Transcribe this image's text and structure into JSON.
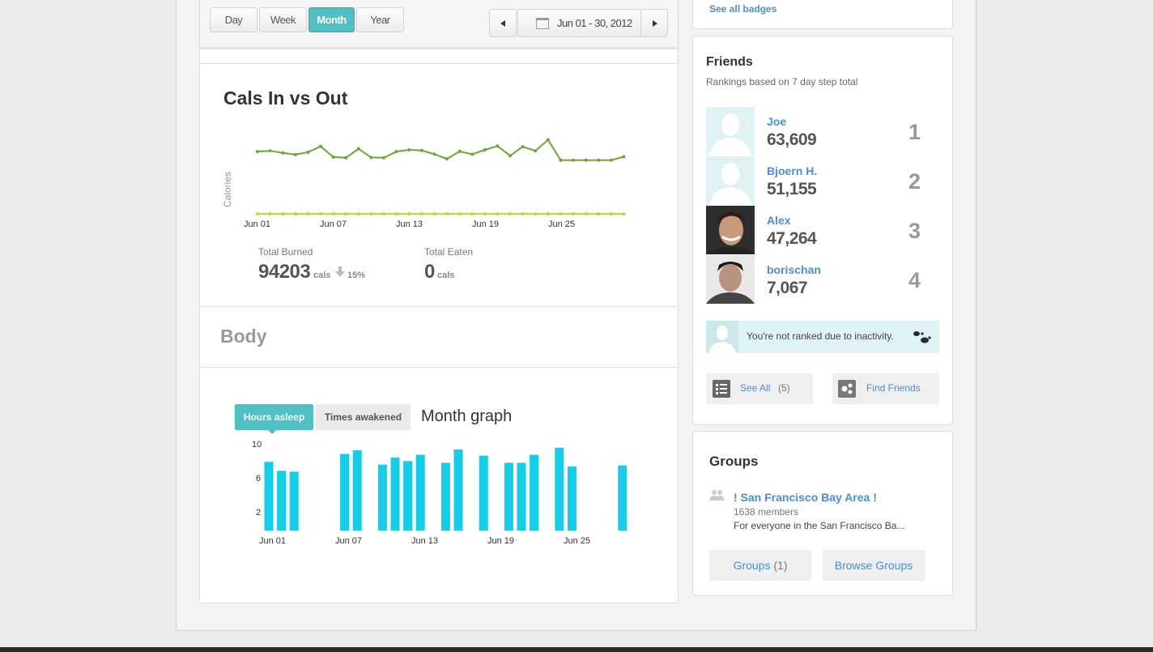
{
  "range_tabs": [
    "Day",
    "Week",
    "Month",
    "Year"
  ],
  "active_tab": "Month",
  "date_range": "Jun 01 - 30, 2012",
  "cals": {
    "title": "Cals In vs Out",
    "ylabel": "Calories",
    "x_ticks": [
      "Jun 01",
      "Jun 07",
      "Jun 13",
      "Jun 19",
      "Jun 25"
    ],
    "total_burned_label": "Total Burned",
    "total_burned_value": "94203",
    "total_burned_unit": "cals",
    "change": "15%",
    "total_eaten_label": "Total Eaten",
    "total_eaten_value": "0",
    "total_eaten_unit": "cals"
  },
  "body_title": "Body",
  "sleep": {
    "tab_on": "Hours asleep",
    "tab_off": "Times awakened",
    "graph_title": "Month graph",
    "y_ticks": [
      "10",
      "6",
      "2"
    ],
    "x_ticks": [
      "Jun 01",
      "Jun 07",
      "Jun 13",
      "Jun 19",
      "Jun 25"
    ]
  },
  "chart_data": [
    {
      "type": "line",
      "title": "Cals In vs Out",
      "ylabel": "Calories",
      "x": [
        "Jun 01",
        "Jun 02",
        "Jun 03",
        "Jun 04",
        "Jun 05",
        "Jun 06",
        "Jun 07",
        "Jun 08",
        "Jun 09",
        "Jun 10",
        "Jun 11",
        "Jun 12",
        "Jun 13",
        "Jun 14",
        "Jun 15",
        "Jun 16",
        "Jun 17",
        "Jun 18",
        "Jun 19",
        "Jun 20",
        "Jun 21",
        "Jun 22",
        "Jun 23",
        "Jun 24",
        "Jun 25",
        "Jun 26",
        "Jun 27",
        "Jun 28",
        "Jun 29",
        "Jun 30"
      ],
      "series": [
        {
          "color": "#6aa930",
          "values": [
            3600,
            3640,
            3520,
            3420,
            3560,
            3900,
            3280,
            3240,
            3760,
            3260,
            3240,
            3600,
            3700,
            3660,
            3450,
            3180,
            3610,
            3440,
            3700,
            3920,
            3360,
            3880,
            3640,
            4280,
            3100,
            3100,
            3100,
            3100,
            3100,
            3300
          ]
        },
        {
          "color": "#b8de2c",
          "values": [
            0,
            0,
            0,
            0,
            0,
            0,
            0,
            0,
            0,
            0,
            0,
            0,
            0,
            0,
            0,
            0,
            0,
            0,
            0,
            0,
            0,
            0,
            0,
            0,
            0,
            0,
            0,
            0,
            0,
            0
          ]
        }
      ],
      "grid": false
    },
    {
      "type": "bar",
      "title": "Month graph",
      "categories": [
        "Jun 01",
        "Jun 02",
        "Jun 03",
        "Jun 04",
        "Jun 05",
        "Jun 06",
        "Jun 07",
        "Jun 08",
        "Jun 09",
        "Jun 10",
        "Jun 11",
        "Jun 12",
        "Jun 13",
        "Jun 14",
        "Jun 15",
        "Jun 16",
        "Jun 17",
        "Jun 18",
        "Jun 19",
        "Jun 20",
        "Jun 21",
        "Jun 22",
        "Jun 23",
        "Jun 24",
        "Jun 25",
        "Jun 26",
        "Jun 27",
        "Jun 28",
        "Jun 29",
        "Jun 30"
      ],
      "values": [
        7.7,
        6.7,
        6.6,
        0,
        0,
        0,
        8.6,
        9.0,
        0,
        7.4,
        8.2,
        7.8,
        8.5,
        0,
        7.6,
        9.1,
        0,
        8.4,
        0,
        7.6,
        7.6,
        8.5,
        0,
        9.3,
        7.2,
        0,
        0,
        0,
        7.3,
        0
      ],
      "ylim": [
        0,
        10
      ],
      "color": "#14cde8"
    }
  ],
  "badges_link": "See all badges",
  "friends": {
    "title": "Friends",
    "subtitle": "Rankings based on 7 day step total",
    "list": [
      {
        "name": "Joe",
        "steps": "63,609",
        "rank": "1"
      },
      {
        "name": "Bjoern H.",
        "steps": "51,155",
        "rank": "2"
      },
      {
        "name": "Alex",
        "steps": "47,264",
        "rank": "3"
      },
      {
        "name": "borischan",
        "steps": "7,067",
        "rank": "4"
      }
    ],
    "inactive_note": "You're not ranked due to inactivity.",
    "see_all": "See All",
    "see_all_count": "(5)",
    "find_friends": "Find Friends"
  },
  "groups": {
    "title": "Groups",
    "group_name": "! San Francisco Bay Area !",
    "members": "1638 members",
    "description": "For everyone in the San Francisco Ba...",
    "groups_button": "Groups",
    "groups_count": "(1)",
    "browse_button": "Browse Groups"
  }
}
